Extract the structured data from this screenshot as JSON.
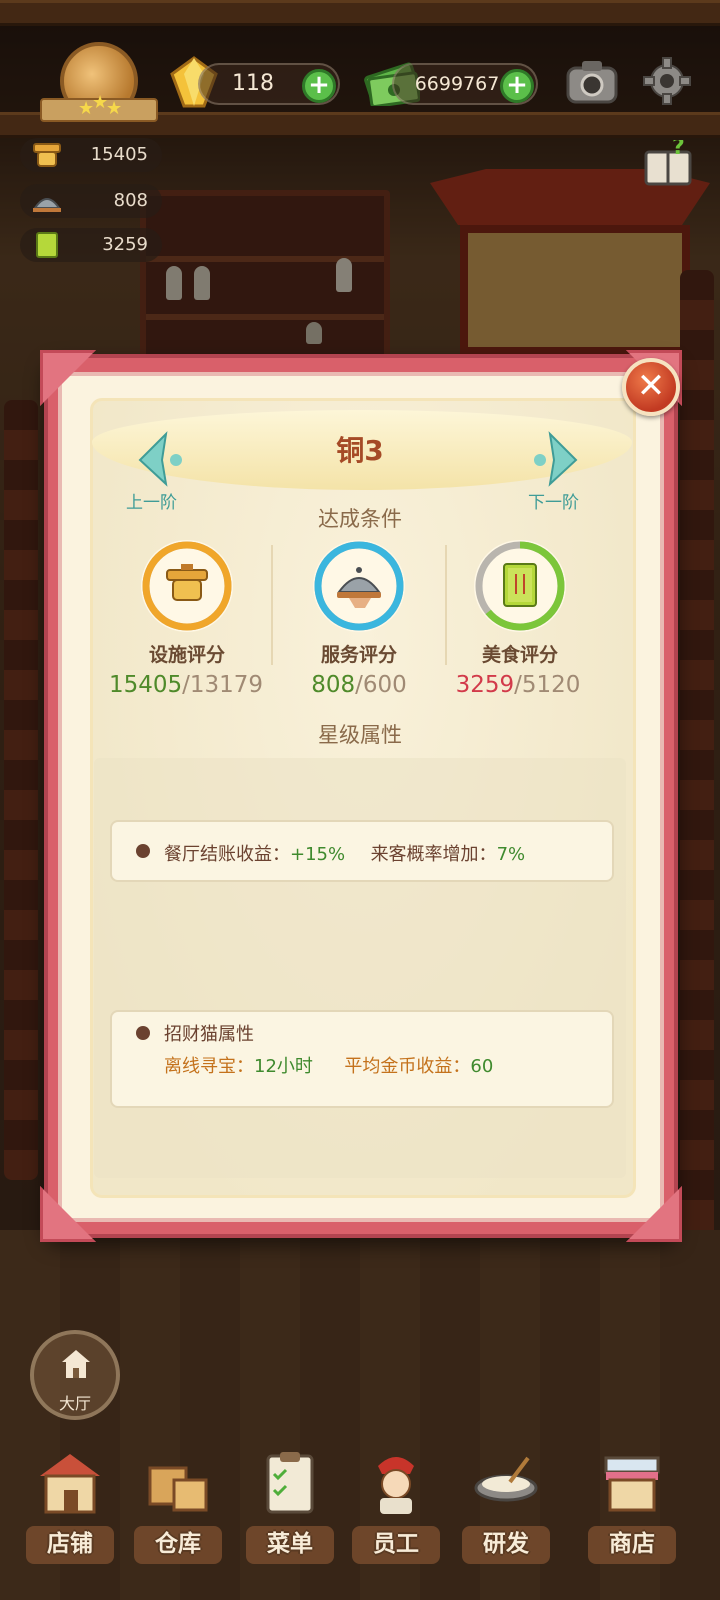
{
  "hud": {
    "gems": "118",
    "cash": "6699767",
    "stats": [
      {
        "name": "facility",
        "value": "15405"
      },
      {
        "name": "service",
        "value": "808"
      },
      {
        "name": "food",
        "value": "3259"
      }
    ]
  },
  "modal": {
    "title": "铜3",
    "prev_label": "上一阶",
    "next_label": "下一阶",
    "conditions_title": "达成条件",
    "scores": [
      {
        "label": "设施评分",
        "current": "15405",
        "target": "/13179",
        "current_color": "#4f8a2a",
        "progress": 1.0,
        "ring_color": "#f0a62a"
      },
      {
        "label": "服务评分",
        "current": "808",
        "target": "/600",
        "current_color": "#4f8a2a",
        "progress": 1.0,
        "ring_color": "#3bb6de"
      },
      {
        "label": "美食评分",
        "current": "3259",
        "target": "/5120",
        "current_color": "#d23a4a",
        "progress": 0.64,
        "ring_color": "#7cc63a"
      }
    ],
    "attributes_title": "星级属性",
    "attr1": {
      "label1": "餐厅结账收益：",
      "value1": "+15%",
      "label2": "来客概率增加：",
      "value2": "7%"
    },
    "attr2": {
      "heading": "招财猫属性",
      "label1": "离线寻宝：",
      "value1": "12小时",
      "label2": "平均金币收益：",
      "value2": "60"
    }
  },
  "hall_label": "大厅",
  "nav": [
    {
      "label": "店铺",
      "icon": "shop-house-icon"
    },
    {
      "label": "仓库",
      "icon": "warehouse-boxes-icon"
    },
    {
      "label": "菜单",
      "icon": "menu-clipboard-icon"
    },
    {
      "label": "员工",
      "icon": "staff-chef-icon"
    },
    {
      "label": "研发",
      "icon": "research-pot-icon"
    },
    {
      "label": "商店",
      "icon": "store-stall-icon"
    }
  ]
}
